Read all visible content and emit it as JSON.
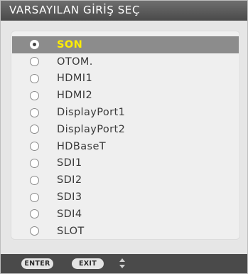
{
  "dialog": {
    "title": "VARSAYILAN GİRİŞ SEÇ"
  },
  "input_list": {
    "selected_index": 0,
    "items": [
      {
        "label": "SON",
        "selected": true
      },
      {
        "label": "OTOM.",
        "selected": false
      },
      {
        "label": "HDMI1",
        "selected": false
      },
      {
        "label": "HDMI2",
        "selected": false
      },
      {
        "label": "DisplayPort1",
        "selected": false
      },
      {
        "label": "DisplayPort2",
        "selected": false
      },
      {
        "label": "HDBaseT",
        "selected": false
      },
      {
        "label": "SDI1",
        "selected": false
      },
      {
        "label": "SDI2",
        "selected": false
      },
      {
        "label": "SDI3",
        "selected": false
      },
      {
        "label": "SDI4",
        "selected": false
      },
      {
        "label": "SLOT",
        "selected": false
      }
    ]
  },
  "footer": {
    "enter_label": "ENTER",
    "exit_label": "EXIT",
    "updown_icon": "up-down-arrows-icon"
  },
  "colors": {
    "title_bar": "#5a5a5a",
    "selection": "#8c8c8c",
    "selected_text": "#ffee00",
    "background": "#e6e6e6"
  }
}
